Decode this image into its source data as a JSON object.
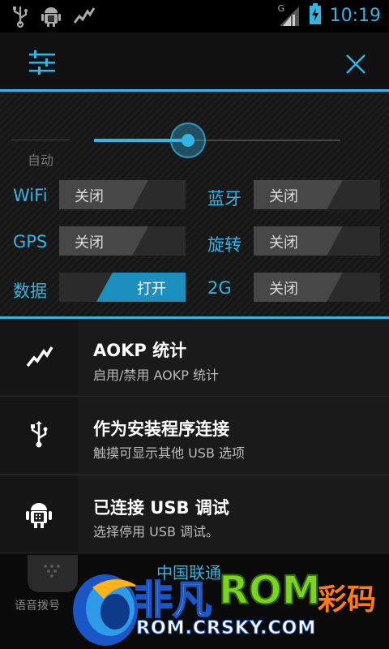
{
  "status_bar": {
    "time": "10:19",
    "network_type": "G",
    "left_icons": [
      "usb-icon",
      "android-debug-icon",
      "activity-graph-icon"
    ],
    "right_icons": [
      "signal-icon",
      "battery-charging-icon"
    ]
  },
  "header": {
    "settings_icon": "sliders-icon",
    "close_icon": "close-icon"
  },
  "brightness": {
    "auto_label": "自动",
    "level_percent": 38
  },
  "toggles": [
    {
      "label": "WiFi",
      "state_label": "关闭",
      "on": false
    },
    {
      "label": "蓝牙",
      "state_label": "关闭",
      "on": false
    },
    {
      "label": "GPS",
      "state_label": "关闭",
      "on": false
    },
    {
      "label": "旋转",
      "state_label": "关闭",
      "on": false
    },
    {
      "label": "数据",
      "state_label": "打开",
      "on": true
    },
    {
      "label": "2G",
      "state_label": "关闭",
      "on": false
    }
  ],
  "notifications": [
    {
      "title": "AOKP 统计",
      "subtitle": "启用/禁用 AOKP 统计",
      "icon": "activity-graph-icon"
    },
    {
      "title": "作为安装程序连接",
      "subtitle": "触摸可显示其他 USB 选项",
      "icon": "usb-icon"
    },
    {
      "title": "已连接 USB 调试",
      "subtitle": "选择停用 USB 调试。",
      "icon": "android-debug-icon"
    }
  ],
  "background": {
    "carrier": "中国联通",
    "dialer_label": "语音拨号"
  },
  "watermark": {
    "brand_cn": "非凡",
    "brand_rom": "ROM",
    "brand_right": "彩码",
    "url": "ROM.CRSKY.COM"
  },
  "colors": {
    "accent": "#33b5e5",
    "switch_on": "#1d8fbe"
  }
}
